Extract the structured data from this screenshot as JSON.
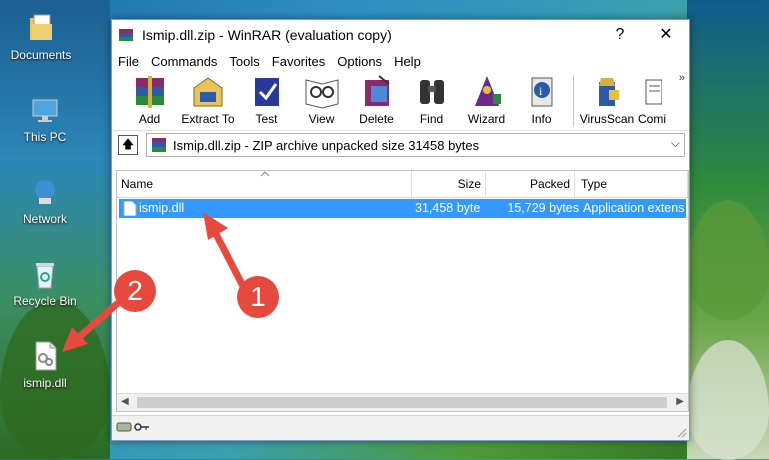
{
  "desktop": {
    "icons": [
      {
        "label": "Documents"
      },
      {
        "label": "This PC"
      },
      {
        "label": "Network"
      },
      {
        "label": "Recycle Bin"
      },
      {
        "label": "ismip.dll"
      }
    ]
  },
  "window": {
    "title": "Ismip.dll.zip - WinRAR (evaluation copy)",
    "help_button": "?",
    "close_button": "✕",
    "menu": [
      "File",
      "Commands",
      "Tools",
      "Favorites",
      "Options",
      "Help"
    ],
    "toolbar": [
      {
        "label": "Add",
        "icon": "add-icon"
      },
      {
        "label": "Extract To",
        "icon": "extract-icon"
      },
      {
        "label": "Test",
        "icon": "test-icon"
      },
      {
        "label": "View",
        "icon": "view-icon"
      },
      {
        "label": "Delete",
        "icon": "delete-icon"
      },
      {
        "label": "Find",
        "icon": "find-icon"
      },
      {
        "label": "Wizard",
        "icon": "wizard-icon"
      },
      {
        "label": "Info",
        "icon": "info-icon"
      },
      {
        "label": "VirusScan",
        "icon": "virusscan-icon"
      },
      {
        "label": "Comi",
        "icon": "comment-icon"
      }
    ],
    "more_tools": "»",
    "address": {
      "up_button": "🡅",
      "path": "Ismip.dll.zip - ZIP archive unpacked size 31458 bytes",
      "dropdown": "⌵"
    },
    "columns": [
      "Name",
      "Size",
      "Packed",
      "Type"
    ],
    "files": [
      {
        "name": "ismip.dll",
        "size": "31,458 byte",
        "packed": "15,729 bytes",
        "type": "Application extens"
      }
    ],
    "scroll_left": "◀",
    "scroll_right": "▶"
  },
  "annotations": [
    {
      "number": "1"
    },
    {
      "number": "2"
    }
  ],
  "colors": {
    "selection": "#3399ff",
    "annotation": "#e8493f"
  }
}
